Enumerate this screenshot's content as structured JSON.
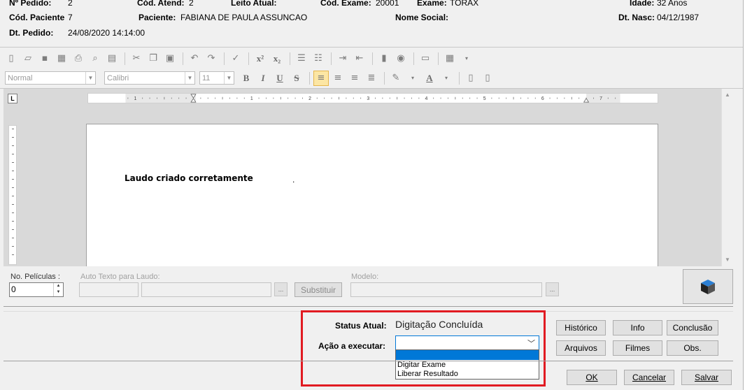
{
  "header": {
    "pedido_label": "Nº Pedido:",
    "pedido_value": "2",
    "atend_label": "Cód. Atend:",
    "atend_value": "2",
    "leito_label": "Leito Atual:",
    "exame_cod_label": "Cód. Exame:",
    "exame_cod_value": "20001",
    "exame_label": "Exame:",
    "exame_value": "TORAX",
    "idade_label": "Idade:",
    "idade_value": "32  Anos",
    "paciente_cod_label": "Cód. Paciente",
    "paciente_cod_value": "7",
    "paciente_label": "Paciente:",
    "paciente_value": "FABIANA DE PAULA ASSUNCAO",
    "nome_social_label": "Nome Social:",
    "dt_nasc_label": "Dt. Nasc:",
    "dt_nasc_value": "04/12/1987",
    "dt_pedido_label": "Dt. Pedido:",
    "dt_pedido_value": "24/08/2020 14:14:00"
  },
  "toolbar": {
    "style_combo": "Normal",
    "font_combo": "Calibri",
    "size_combo": "11"
  },
  "editor": {
    "ruler_corner": "L",
    "ruler_numbers": [
      "1",
      "1",
      "2",
      "3",
      "4",
      "5",
      "6",
      "7"
    ],
    "document_text": "Laudo criado corretamente",
    "document_dot": "."
  },
  "fields": {
    "peliculas_label": "No. Películas :",
    "peliculas_value": "0",
    "auto_texto_label": "Auto Texto para Laudo:",
    "substituir_label": "Substituir",
    "modelo_label": "Modelo:",
    "ellipsis": "..."
  },
  "status": {
    "status_label": "Status Atual:",
    "status_value": "Digitação Concluída",
    "acao_label": "Ação a executar:",
    "acao_selected": "",
    "acao_options": [
      "Digitar Exame",
      "Liberar Resultado"
    ]
  },
  "buttons": {
    "historico": "Histórico",
    "info": "Info",
    "conclusao": "Conclusão",
    "arquivos": "Arquivos",
    "filmes": "Filmes",
    "obs": "Obs.",
    "ok": "OK",
    "cancelar": "Cancelar",
    "salvar": "Salvar"
  },
  "colors": {
    "highlight_box": "#e11b22",
    "selection": "#0078d7"
  }
}
